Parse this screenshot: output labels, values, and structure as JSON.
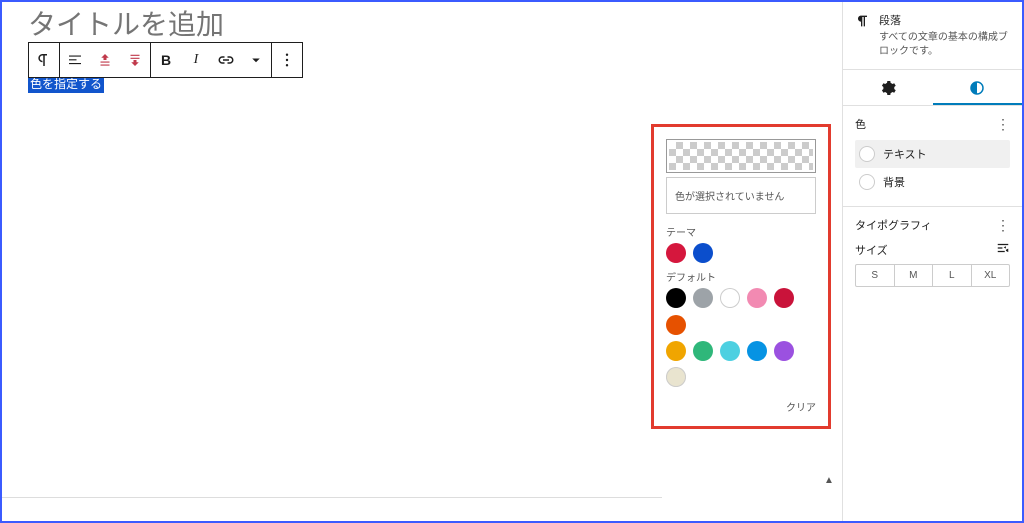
{
  "editor": {
    "title_placeholder": "タイトルを追加",
    "highlighted_text": "色を指定する"
  },
  "toolbar": {
    "paragraph_icon": "¶",
    "bold_label": "B",
    "italic_label": "I"
  },
  "sidebar": {
    "block_name": "段落",
    "block_desc": "すべての文章の基本の構成ブロックです。",
    "color_section": "色",
    "text_color_label": "テキスト",
    "bg_color_label": "背景",
    "typo_section": "タイポグラフィ",
    "size_label": "サイズ",
    "sizes": [
      "S",
      "M",
      "L",
      "XL"
    ]
  },
  "color_popup": {
    "none_selected": "色が選択されていません",
    "theme_label": "テーマ",
    "default_label": "デフォルト",
    "clear_label": "クリア",
    "theme_colors": [
      "#d5173d",
      "#0b4ecc"
    ],
    "default_colors_row1": [
      "#000000",
      "#9da3a8",
      "#ffffff",
      "#f28ab2",
      "#c9133a",
      "#e65100"
    ],
    "default_colors_row2": [
      "#f0a500",
      "#2fb77a",
      "#4dd0e1",
      "#0693e3",
      "#9b51e0"
    ],
    "default_colors_row3": [
      "#e9e4cf"
    ]
  }
}
